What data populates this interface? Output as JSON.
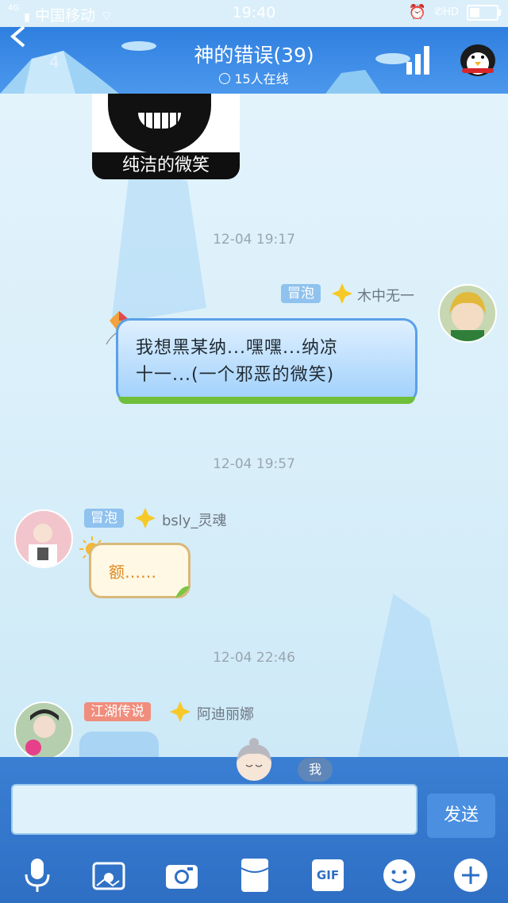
{
  "status_bar": {
    "carrier": "中国移动",
    "signal_label": "4G",
    "time": "19:40",
    "hd_label": "HD"
  },
  "header": {
    "back_count": "4",
    "title": "神的错误(39)",
    "online": "15人在线"
  },
  "chat": {
    "image_caption": "纯洁的微笑",
    "messages": [
      {
        "timestamp": "12-04 19:17",
        "badge": "冒泡",
        "badge_color": "#8fc2ee",
        "nickname": "木中无一",
        "text_line1": "我想黑某纳...嘿嘿...纳凉",
        "text_line2": "十一...(一个邪恶的微笑)"
      },
      {
        "timestamp": "12-04 19:57",
        "badge": "冒泡",
        "badge_color": "#8fc2ee",
        "nickname": "bsly_灵魂",
        "text": "额……"
      },
      {
        "timestamp": "12-04 22:46",
        "badge": "江湖传说",
        "badge_color": "#f08d7c",
        "nickname": "阿迪丽娜"
      }
    ]
  },
  "compose": {
    "me_label": "我",
    "send_label": "发送",
    "gif_label": "GIF"
  },
  "colors": {
    "header_blue": "#3a8ae6",
    "send_button": "#4a8fe0"
  },
  "toolbar_icons": [
    "microphone-icon",
    "photo-album-icon",
    "camera-icon",
    "red-packet-icon",
    "gif-icon",
    "emoji-icon",
    "plus-icon"
  ]
}
